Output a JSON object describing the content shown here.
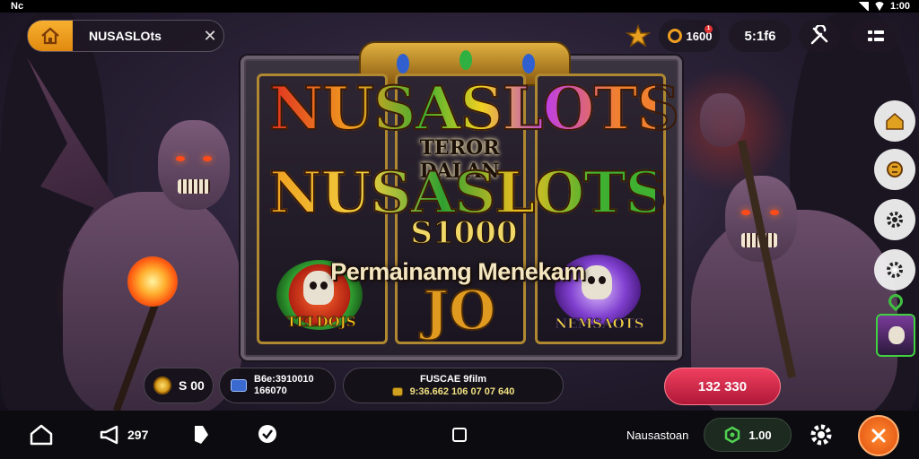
{
  "status_bar": {
    "carrier": "Nc",
    "time": "1:00"
  },
  "search": {
    "label": "NUSASLOts",
    "close": "✕"
  },
  "top_bar": {
    "coins": "1600",
    "level": "5:1f6",
    "notif": "1"
  },
  "game": {
    "title1": "NUSASLOTS",
    "subtitle": "TEROR DALAN",
    "title2": "NUSASLOTS",
    "amount": "S1000",
    "tagline": "Permainamg Menekam",
    "reel_symbol": "JO",
    "badge_left": "TELDOJS",
    "badge_right": "NEMSAOTS"
  },
  "game_bar": {
    "balance": "S 00",
    "bet_line1": "B6e:3910010",
    "bet_line2": "166070",
    "win_label": "FUSCAE 9film",
    "win_value": "9:36.662 106 07 07 640",
    "spin_label": "132 330"
  },
  "nav": {
    "share_count": "297",
    "brand": "Nausastoan",
    "balance": "1.00"
  },
  "colors": {
    "accent": "#f0a020",
    "spin": "#e0304f",
    "brand_green": "#40c040"
  }
}
